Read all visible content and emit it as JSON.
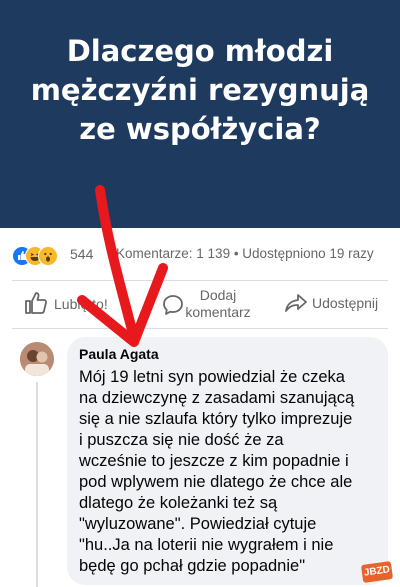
{
  "banner": {
    "title": "Dlaczego młodzi\nmężczyźni rezygnują\nze współżycia?",
    "background": "#1e3a5f"
  },
  "stats": {
    "reaction_icons": [
      "like-icon",
      "haha-icon",
      "wow-icon"
    ],
    "reaction_count": "544",
    "comments_shares": "Komentarze: 1 139 • Udostępniono 19 razy"
  },
  "actions": {
    "like": {
      "label": "Lubię to!",
      "icon": "thumbs-up-icon"
    },
    "comment": {
      "label": "Dodaj\nkomentarz",
      "icon": "comment-bubble-icon"
    },
    "share": {
      "label": "Udostępnij",
      "icon": "share-arrow-icon"
    }
  },
  "comment": {
    "author": "Paula Agata",
    "text": "Mój 19 letni syn powiedzial że czeka\nna dziewczynę z zasadami szanującą\nsię a nie szlaufa który tylko imprezuje\ni puszcza się nie dość że za\nwcześnie to jeszcze z kim popadnie i\npod wplywem nie dlatego że chce ale\ndlatego że koleżanki też są\n\"wyluzowane\". Powiedział cytuje\n\"hu..Ja  na loterii nie wygrałem i nie\nbędę go pchał gdzie popadnie\""
  },
  "overlay": {
    "arrow_color": "#e8191c"
  },
  "watermark": {
    "text": "JBZD"
  }
}
